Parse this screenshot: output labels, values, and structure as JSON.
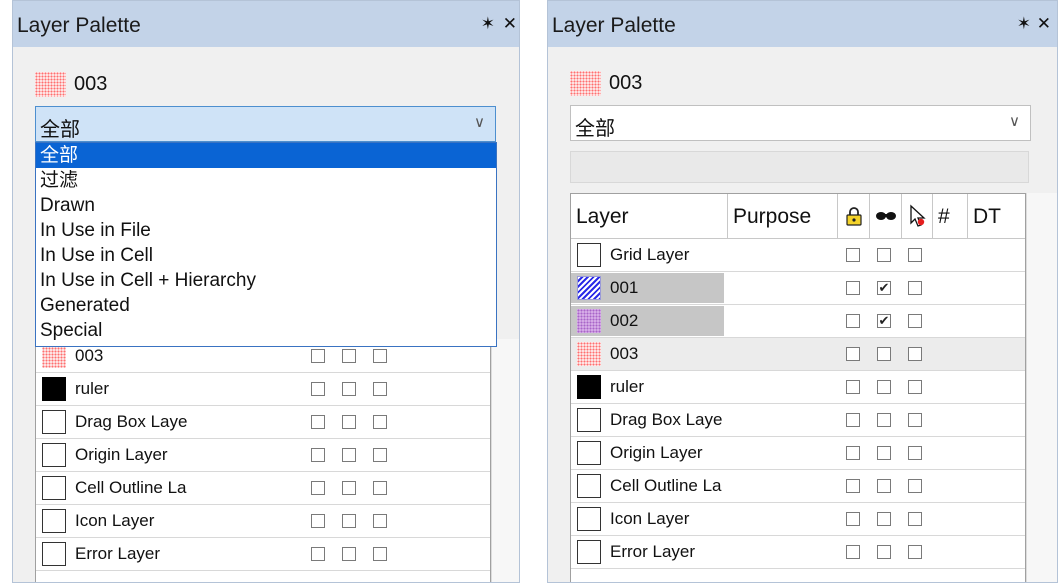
{
  "left": {
    "title": "Layer Palette",
    "pin_glyph": "✶",
    "close_glyph": "✕",
    "current_layer": "003",
    "combo_value": "全部",
    "dropdown_options": [
      "全部",
      "过滤",
      "Drawn",
      "In Use in File",
      "In Use in Cell",
      "In Use in Cell + Hierarchy",
      "Generated",
      "Special"
    ],
    "rows": [
      {
        "name": "003",
        "swatch": "dots"
      },
      {
        "name": "ruler",
        "swatch": "black"
      },
      {
        "name": "Drag Box Laye",
        "swatch": "empty"
      },
      {
        "name": "Origin Layer",
        "swatch": "empty"
      },
      {
        "name": "Cell Outline La",
        "swatch": "empty"
      },
      {
        "name": "Icon Layer",
        "swatch": "empty"
      },
      {
        "name": "Error Layer",
        "swatch": "empty"
      }
    ]
  },
  "right": {
    "title": "Layer Palette",
    "pin_glyph": "✶",
    "close_glyph": "✕",
    "current_layer": "003",
    "combo_value": "全部",
    "columns": {
      "layer": "Layer",
      "purpose": "Purpose",
      "lock_icon": "lock-icon",
      "visible_icon": "eye-icon",
      "select_icon": "cursor-icon",
      "number": "#",
      "dt": "DT"
    },
    "rows": [
      {
        "name": "Grid Layer",
        "swatch": "empty",
        "vis_checked": false
      },
      {
        "name": "001",
        "swatch": "diag",
        "vis_checked": true
      },
      {
        "name": "002",
        "swatch": "violet",
        "vis_checked": true
      },
      {
        "name": "003",
        "swatch": "dots",
        "vis_checked": false
      },
      {
        "name": "ruler",
        "swatch": "black",
        "vis_checked": false
      },
      {
        "name": "Drag Box Laye",
        "swatch": "empty",
        "vis_checked": false
      },
      {
        "name": "Origin Layer",
        "swatch": "empty",
        "vis_checked": false
      },
      {
        "name": "Cell Outline La",
        "swatch": "empty",
        "vis_checked": false
      },
      {
        "name": "Icon Layer",
        "swatch": "empty",
        "vis_checked": false
      },
      {
        "name": "Error Layer",
        "swatch": "empty",
        "vis_checked": false
      }
    ]
  },
  "check_glyph": "✔",
  "chevron_glyph": "∨"
}
